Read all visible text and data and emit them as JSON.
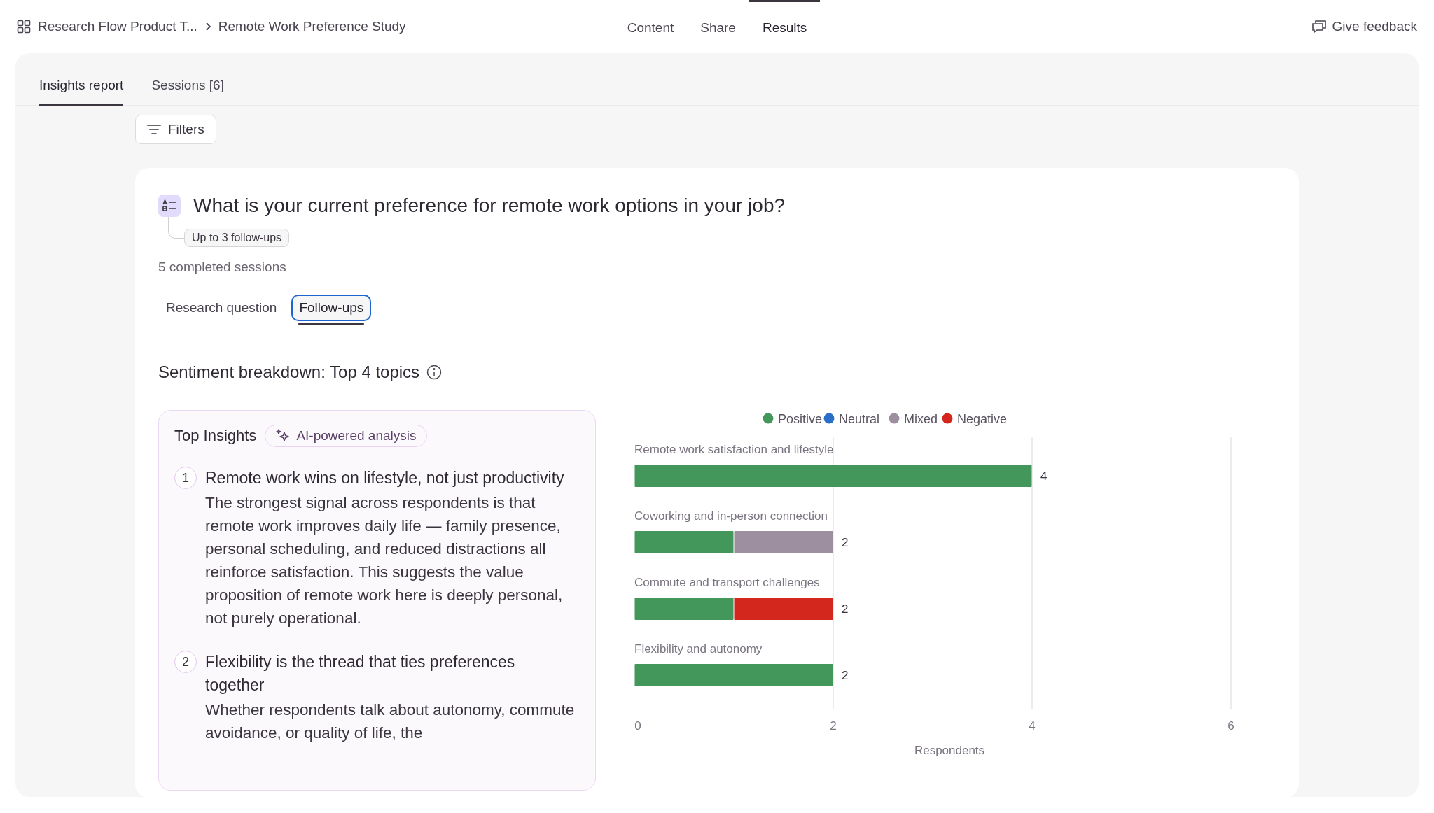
{
  "breadcrumb": [
    {
      "label": "Research Flow Product T..."
    },
    {
      "label": "Remote Work Preference Study"
    }
  ],
  "nav_tabs": [
    {
      "label": "Content",
      "selected": false
    },
    {
      "label": "Share",
      "selected": false
    },
    {
      "label": "Results",
      "selected": true
    }
  ],
  "feedback_button": {
    "label": "Give feedback"
  },
  "report_tabs": [
    {
      "label": "Insights report",
      "selected": true
    },
    {
      "label": "Sessions [6]",
      "selected": false
    }
  ],
  "filters_button": {
    "label": "Filters"
  },
  "question": {
    "text": "What is your current preference for remote work options in your job?",
    "followup_badge": "Up to 3 follow-ups",
    "sessions": "5 completed sessions"
  },
  "view_tabs": [
    {
      "label": "Research question",
      "selected": false
    },
    {
      "label": "Follow-ups",
      "selected": true
    }
  ],
  "sentiment": {
    "title": "Sentiment breakdown: Top 4 topics"
  },
  "insights": {
    "title": "Top Insights",
    "badge": "AI-powered analysis",
    "items": [
      {
        "number": "1",
        "title": "Remote work wins on lifestyle, not just productivity",
        "body": "The strongest signal across respondents is that remote work improves daily life — family presence, personal scheduling, and reduced distractions all reinforce satisfaction. This suggests the value proposition of remote work here is deeply personal, not purely operational."
      },
      {
        "number": "2",
        "title": "Flexibility is the thread that ties preferences together",
        "body": "Whether respondents talk about autonomy, commute avoidance, or quality of life, the"
      }
    ]
  },
  "chart_data": {
    "type": "bar",
    "orientation": "horizontal",
    "stacked": true,
    "xlabel": "Respondents",
    "categories": [
      "Remote work satisfaction and lifestyle",
      "Coworking and in-person connection",
      "Commute and transport challenges",
      "Flexibility and autonomy"
    ],
    "series": [
      {
        "name": "Positive",
        "color": "#43975a",
        "values": [
          4,
          1,
          1,
          2
        ]
      },
      {
        "name": "Neutral",
        "color": "#2a6fc6",
        "values": [
          0,
          0,
          0,
          0
        ]
      },
      {
        "name": "Mixed",
        "color": "#9e8fa0",
        "values": [
          0,
          1,
          0,
          0
        ]
      },
      {
        "name": "Negative",
        "color": "#d3271d",
        "values": [
          0,
          0,
          1,
          0
        ]
      }
    ],
    "xlim": [
      0,
      6
    ],
    "xticks": [
      0,
      2,
      4,
      6
    ],
    "legend": "top",
    "value_labels": [
      [
        "4",
        null,
        null,
        "2"
      ],
      [
        null,
        null,
        null,
        null
      ],
      [
        null,
        "2",
        null,
        null
      ],
      [
        null,
        null,
        "2",
        null
      ]
    ]
  }
}
